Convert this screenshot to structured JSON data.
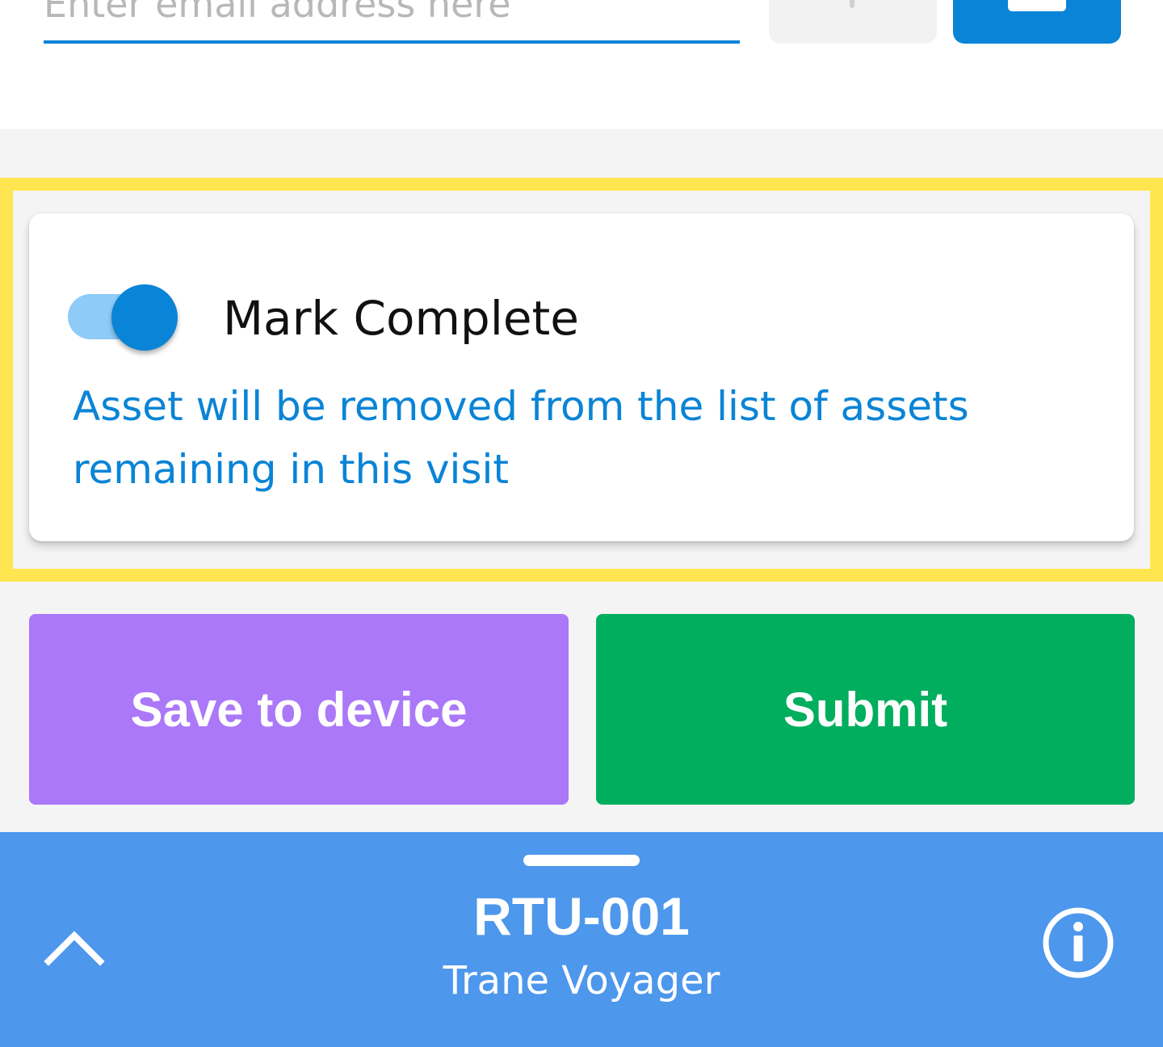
{
  "email": {
    "placeholder": "Enter email address here",
    "value": ""
  },
  "mark_complete": {
    "label": "Mark Complete",
    "checked": true,
    "note": "Asset will be removed from the list of assets remaining in this visit"
  },
  "actions": {
    "save_label": "Save to device",
    "submit_label": "Submit"
  },
  "asset": {
    "id": "RTU-001",
    "model": "Trane Voyager"
  },
  "colors": {
    "accent": "#0a84d6",
    "save_button": "#aa78f8",
    "submit_button": "#00ae5e",
    "bottom_sheet": "#4d97ec",
    "highlight": "#ffe650"
  },
  "icons": {
    "add": "plus-icon",
    "save": "save-icon",
    "expand": "chevron-up-icon",
    "info": "info-icon"
  }
}
